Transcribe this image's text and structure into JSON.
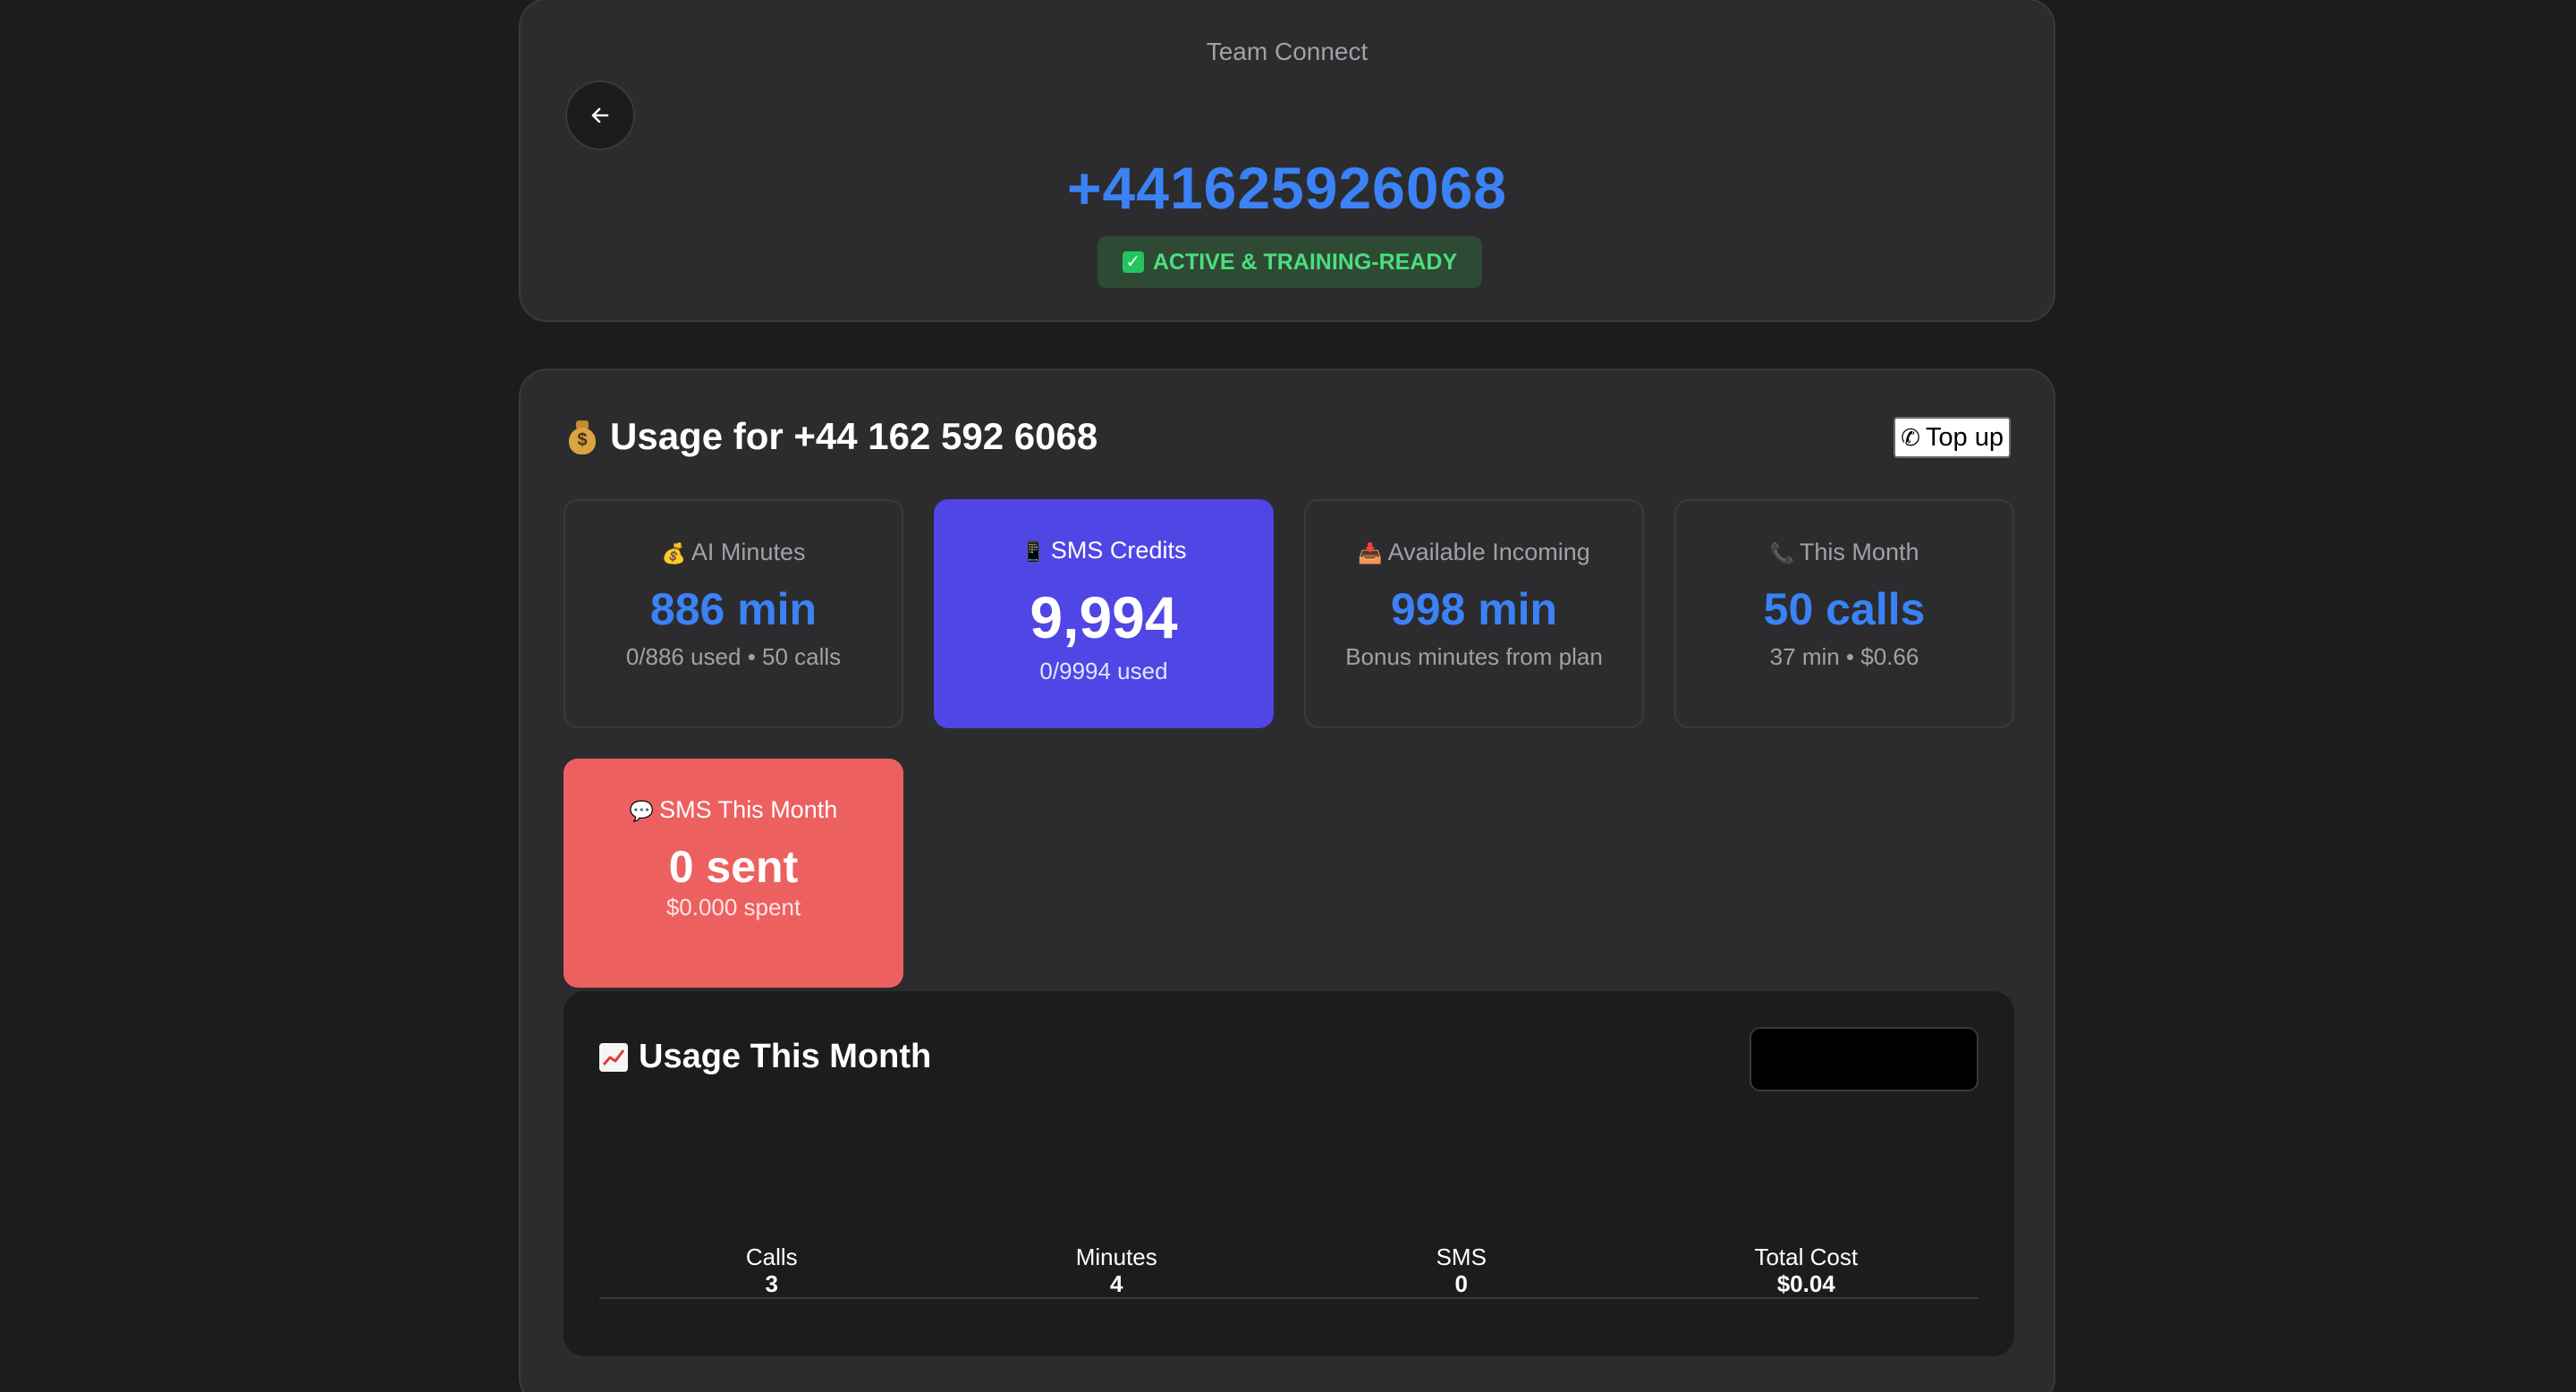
{
  "header": {
    "app_title": "Team Connect",
    "phone_number": "+441625926068",
    "status": "ACTIVE & TRAINING-READY"
  },
  "usage": {
    "title": "Usage for +44 162 592 6068",
    "topup_label": "Top up",
    "tiles": {
      "ai_minutes": {
        "label": "AI Minutes",
        "value": "886 min",
        "sub": "0/886 used • 50 calls"
      },
      "sms_credits": {
        "label": "SMS Credits",
        "value": "9,994",
        "sub": "0/9994 used"
      },
      "incoming": {
        "label": "Available Incoming",
        "value": "998 min",
        "sub": "Bonus minutes from plan"
      },
      "this_month": {
        "label": "This Month",
        "value": "50 calls",
        "sub": "37 min • $0.66"
      },
      "sms_month": {
        "label": "SMS This Month",
        "value": "0 sent",
        "sub": "$0.000 spent"
      }
    }
  },
  "month_panel": {
    "title": "Usage This Month",
    "select_value": "",
    "summary": [
      {
        "label": "Calls",
        "value": "3"
      },
      {
        "label": "Minutes",
        "value": "4"
      },
      {
        "label": "SMS",
        "value": "0"
      },
      {
        "label": "Total Cost",
        "value": "$0.04"
      }
    ]
  },
  "colors": {
    "background": "#1c1c1e",
    "card": "#2c2c2e",
    "accent_blue": "#3b82f6",
    "sms_tile": "#4f46e5",
    "sms_month_tile": "#ec6160",
    "status_green": "#4ade80"
  },
  "icons": {
    "back": "arrow-left-icon",
    "status": "check-icon",
    "usage": "moneybag-icon",
    "topup": "phone-icon",
    "chart": "chart-increasing-icon"
  }
}
